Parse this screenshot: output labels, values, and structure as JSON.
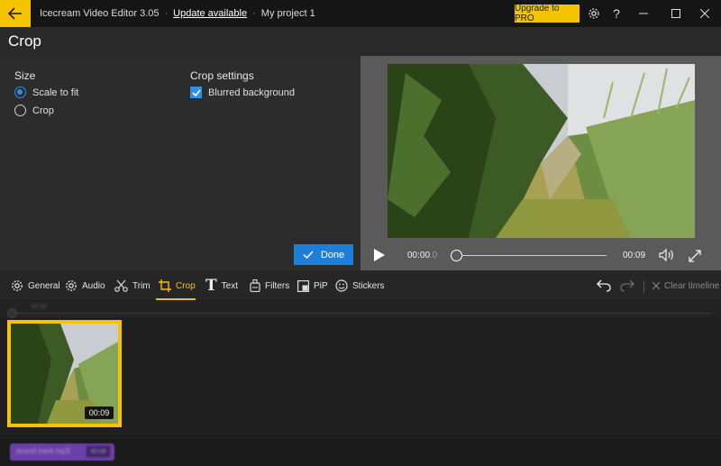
{
  "titlebar": {
    "app_title": "Icecream Video Editor 3.05",
    "update_link": "Update available",
    "project_name": "My project 1",
    "upgrade_label": "Upgrade to PRO",
    "accent_color": "#f5c400"
  },
  "header": {
    "title": "Crop"
  },
  "settings": {
    "size_label": "Size",
    "size_options": [
      {
        "label": "Scale to fit",
        "selected": true
      },
      {
        "label": "Crop",
        "selected": false
      }
    ],
    "crop_settings_label": "Crop settings",
    "blurred_background_label": "Blurred background",
    "blurred_background_checked": true,
    "done_label": "Done"
  },
  "player": {
    "current_time": "00:00",
    "current_time_fraction": ".0",
    "duration": "00:09",
    "progress": 0
  },
  "tabs": [
    {
      "label": "General",
      "icon": "gear-icon"
    },
    {
      "label": "Audio",
      "icon": "gear-icon"
    },
    {
      "label": "Trim",
      "icon": "scissors-icon"
    },
    {
      "label": "Crop",
      "icon": "crop-icon",
      "active": true
    },
    {
      "label": "Text",
      "icon": "text-icon"
    },
    {
      "label": "Filters",
      "icon": "filters-icon"
    },
    {
      "label": "PiP",
      "icon": "pip-icon"
    },
    {
      "label": "Stickers",
      "icon": "smiley-icon"
    }
  ],
  "timeline": {
    "clear_label": "Clear timeline",
    "ruler_label": "00:00",
    "clip_duration": "00:09",
    "audio_clip_name": "sound track.mp3",
    "audio_clip_duration": "00:09"
  }
}
